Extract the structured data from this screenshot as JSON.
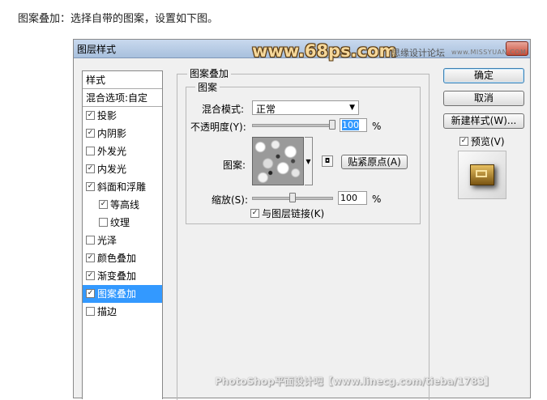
{
  "caption": "图案叠加：选择自带的图案，设置如下图。",
  "dialog": {
    "title": "图层样式",
    "watermark": "www.68ps.com",
    "site_text": "思缘设计论坛",
    "site_url": "www.MISSYUAN.COM"
  },
  "left_panel": {
    "header": "样式",
    "blend_options": "混合选项:自定",
    "items": [
      {
        "label": "投影",
        "checked": true
      },
      {
        "label": "内阴影",
        "checked": true
      },
      {
        "label": "外发光",
        "checked": false
      },
      {
        "label": "内发光",
        "checked": true
      },
      {
        "label": "斜面和浮雕",
        "checked": true
      },
      {
        "label": "等高线",
        "checked": true
      },
      {
        "label": "纹理",
        "checked": false
      },
      {
        "label": "光泽",
        "checked": false
      },
      {
        "label": "颜色叠加",
        "checked": true
      },
      {
        "label": "渐变叠加",
        "checked": true
      },
      {
        "label": "图案叠加",
        "checked": true
      },
      {
        "label": "描边",
        "checked": false
      }
    ]
  },
  "pattern_overlay": {
    "group_title": "图案叠加",
    "sub_group_title": "图案",
    "blend_mode_label": "混合模式:",
    "blend_mode_value": "正常",
    "opacity_label": "不透明度(Y):",
    "opacity_value": "100",
    "opacity_unit": "%",
    "pattern_label": "图案:",
    "snap_button": "贴紧原点(A)",
    "scale_label": "缩放(S):",
    "scale_value": "100",
    "scale_unit": "%",
    "link_label": "与图层链接(K)",
    "link_checked": true
  },
  "right_panel": {
    "ok_button": "确定",
    "cancel_button": "取消",
    "new_style_button": "新建样式(W)...",
    "preview_label": "预览(V)",
    "preview_checked": true
  },
  "footer": "PhotoShop平面设计吧【www.linecg.com/tieba/1783】"
}
